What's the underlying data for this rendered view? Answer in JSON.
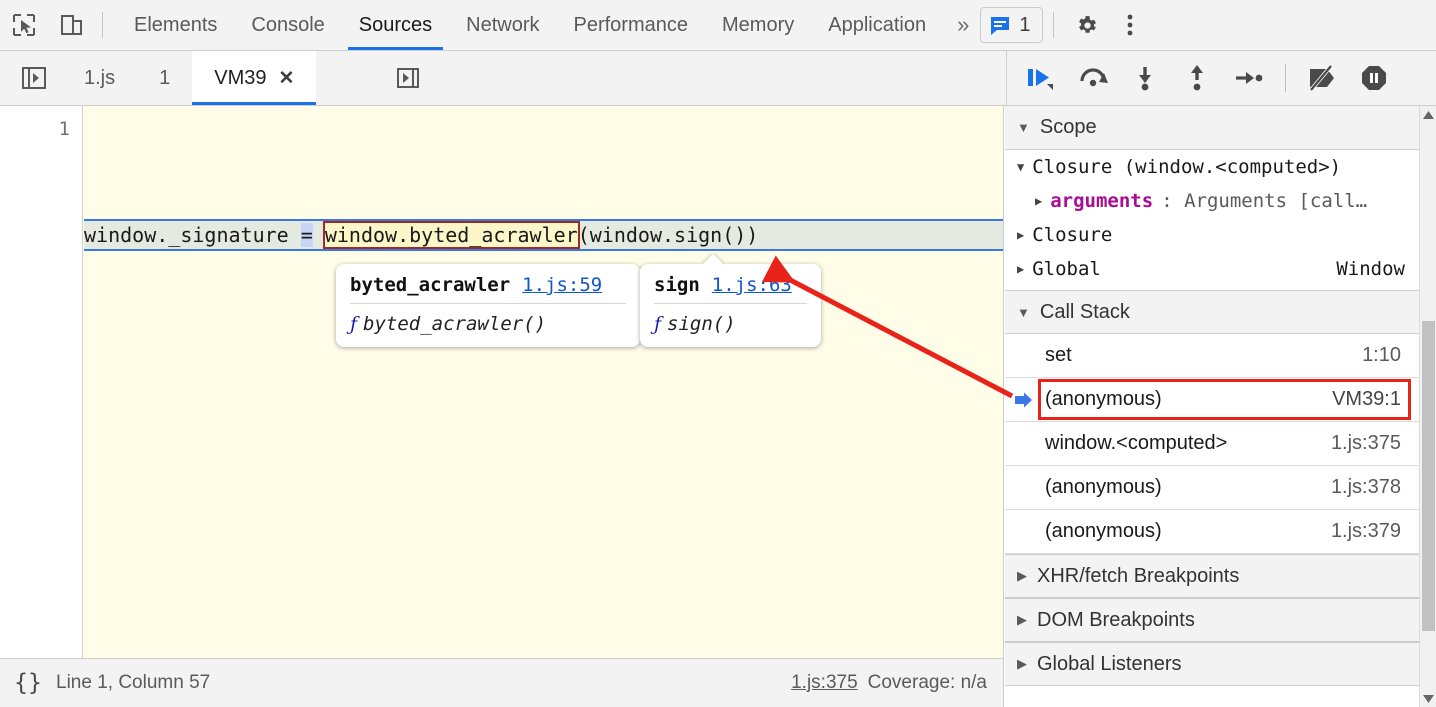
{
  "toolbar": {
    "inspect_icon": "cursor-select-icon",
    "device_icon": "device-toolbar-icon",
    "panels": [
      {
        "label": "Elements",
        "active": false
      },
      {
        "label": "Console",
        "active": false
      },
      {
        "label": "Sources",
        "active": true
      },
      {
        "label": "Network",
        "active": false
      },
      {
        "label": "Performance",
        "active": false
      },
      {
        "label": "Memory",
        "active": false
      },
      {
        "label": "Application",
        "active": false
      }
    ],
    "more_panels": "»",
    "message_count": "1",
    "message_icon": "message-bubble-icon",
    "settings_icon": "gear-icon",
    "menu_icon": "kebab-menu-icon"
  },
  "sources": {
    "nav_toggle_icon": "show-navigator-icon",
    "tabs": [
      {
        "label": "1.js",
        "active": false,
        "closable": false
      },
      {
        "label": "1",
        "active": false,
        "closable": false
      },
      {
        "label": "VM39",
        "active": true,
        "closable": true
      }
    ],
    "close_glyph": "✕",
    "pretty_print_icon": "format-source-icon"
  },
  "debugger_controls": [
    {
      "name": "resume-script-execution",
      "icon": "resume-icon"
    },
    {
      "name": "step-over-next-function-call",
      "icon": "step-over-icon"
    },
    {
      "name": "step-into-next-function-call",
      "icon": "step-into-icon"
    },
    {
      "name": "step-out-of-current-function",
      "icon": "step-out-icon"
    },
    {
      "name": "step",
      "icon": "step-icon"
    },
    {
      "name": "deactivate-breakpoints",
      "icon": "deactivate-breakpoints-icon"
    },
    {
      "name": "pause-on-exceptions",
      "icon": "pause-on-exceptions-icon"
    }
  ],
  "editor": {
    "line_number": "1",
    "code": {
      "prefix": "window._signature ",
      "operator": "=",
      "space": " ",
      "highlighted": "window.byted_acrawler",
      "suffix": "(window.sign())"
    }
  },
  "tooltips": [
    {
      "name": "byted_acrawler",
      "link": "1.js:59",
      "fn_glyph": "ƒ",
      "signature": "byted_acrawler()"
    },
    {
      "name": "sign",
      "link": "1.js:63",
      "fn_glyph": "ƒ",
      "signature": "sign()"
    }
  ],
  "status_bar": {
    "format_icon": "{}",
    "position": "Line 1, Column 57",
    "source_link": "1.js:375",
    "coverage": "Coverage: n/a"
  },
  "sidebar": {
    "scope": {
      "title": "Scope",
      "caret": "▼",
      "rows": [
        {
          "caret": "▼",
          "label": "Closure (window.<computed>)",
          "indent": false,
          "key": "",
          "value": "",
          "right": ""
        },
        {
          "caret": "▶",
          "label": "",
          "indent": true,
          "key": "arguments",
          "value": ": Arguments [call…",
          "right": ""
        },
        {
          "caret": "▶",
          "label": "Closure",
          "indent": false,
          "key": "",
          "value": "",
          "right": ""
        },
        {
          "caret": "▶",
          "label": "Global",
          "indent": false,
          "key": "",
          "value": "",
          "right": "Window"
        }
      ]
    },
    "call_stack": {
      "title": "Call Stack",
      "caret": "▼",
      "rows": [
        {
          "name": "set",
          "location": "1:10",
          "selected": false
        },
        {
          "name": "(anonymous)",
          "location": "VM39:1",
          "selected": true
        },
        {
          "name": "window.<computed>",
          "location": "1.js:375",
          "selected": false
        },
        {
          "name": "(anonymous)",
          "location": "1.js:378",
          "selected": false
        },
        {
          "name": "(anonymous)",
          "location": "1.js:379",
          "selected": false
        }
      ]
    },
    "sections": [
      {
        "title": "XHR/fetch Breakpoints",
        "caret": "▶"
      },
      {
        "title": "DOM Breakpoints",
        "caret": "▶"
      },
      {
        "title": "Global Listeners",
        "caret": "▶"
      }
    ]
  },
  "annotation": {
    "arrow_color": "#e8231a",
    "highlight_box_color": "#e8231a"
  },
  "colors": {
    "accent": "#1a73e8",
    "editor_background": "#fffde7",
    "active_line": "#e5eae1",
    "token_box_border": "#9a2c22",
    "token_box_fill": "#fdf6c8"
  }
}
